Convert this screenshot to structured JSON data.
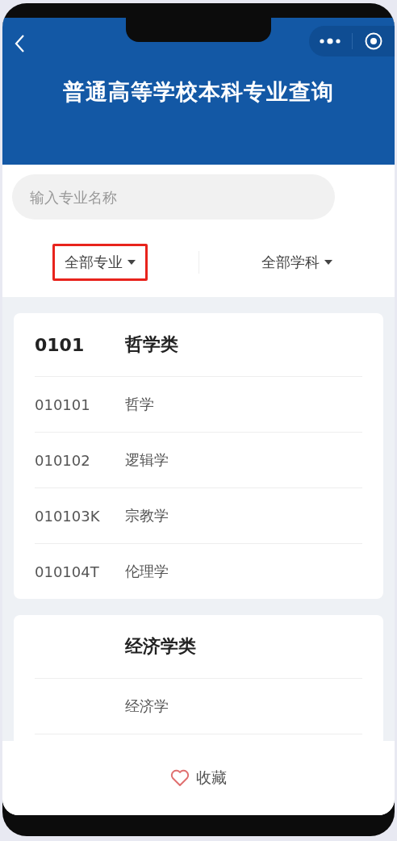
{
  "header": {
    "title": "普通高等学校本科专业查询"
  },
  "search": {
    "placeholder": "输入专业名称"
  },
  "filters": [
    {
      "label": "全部专业",
      "highlighted": true
    },
    {
      "label": "全部学科",
      "highlighted": false
    }
  ],
  "groups": [
    {
      "code": "0101",
      "name": "哲学类",
      "majors": [
        {
          "code": "010101",
          "name": "哲学"
        },
        {
          "code": "010102",
          "name": "逻辑学"
        },
        {
          "code": "010103K",
          "name": "宗教学"
        },
        {
          "code": "010104T",
          "name": "伦理学"
        }
      ]
    },
    {
      "name": "经济学类",
      "majors": [
        {
          "name": "经济学"
        }
      ]
    }
  ],
  "bottom_bar": {
    "label": "收藏"
  }
}
